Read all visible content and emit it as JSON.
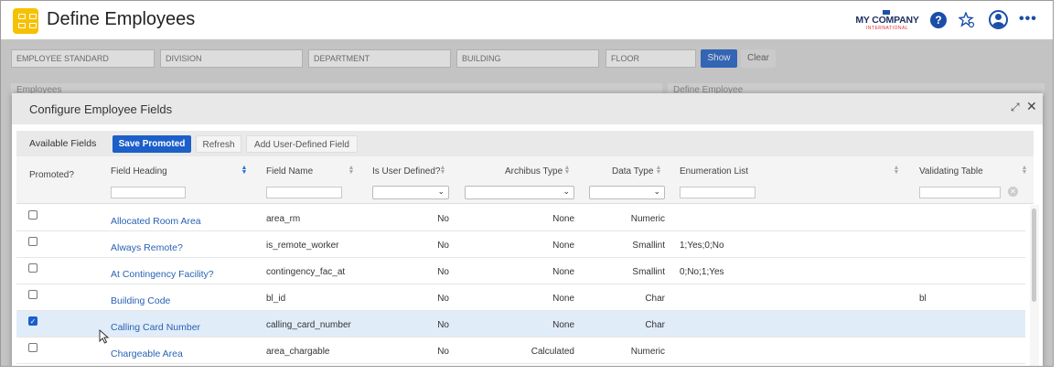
{
  "app": {
    "title": "Define Employees",
    "logo_name": "MY COMPANY",
    "logo_sub": "INTERNATIONAL",
    "help_label": "?",
    "more_label": "•••"
  },
  "filters": {
    "employee_standard": "EMPLOYEE STANDARD",
    "division": "DIVISION",
    "department": "DEPARTMENT",
    "building": "BUILDING",
    "floor": "FLOOR",
    "show_label": "Show",
    "clear_label": "Clear"
  },
  "background_panels": {
    "left_tabs": "Employees",
    "right_title": "Define Employee"
  },
  "dialog": {
    "title": "Configure Employee Fields",
    "toolbar": {
      "available_label": "Available Fields",
      "save_label": "Save Promoted",
      "refresh_label": "Refresh",
      "add_label": "Add User-Defined Field"
    },
    "columns": {
      "promoted": "Promoted?",
      "heading": "Field Heading",
      "name": "Field Name",
      "user_defined": "Is User Defined?",
      "archibus_type": "Archibus Type",
      "data_type": "Data Type",
      "enum_list": "Enumeration List",
      "validating_table": "Validating Table"
    },
    "rows": [
      {
        "promoted": false,
        "heading": "Allocated Room Area",
        "name": "area_rm",
        "user_defined": "No",
        "archibus_type": "None",
        "data_type": "Numeric",
        "enum_list": "",
        "validating_table": ""
      },
      {
        "promoted": false,
        "heading": "Always Remote?",
        "name": "is_remote_worker",
        "user_defined": "No",
        "archibus_type": "None",
        "data_type": "Smallint",
        "enum_list": "1;Yes;0;No",
        "validating_table": ""
      },
      {
        "promoted": false,
        "heading": "At Contingency Facility?",
        "name": "contingency_fac_at",
        "user_defined": "No",
        "archibus_type": "None",
        "data_type": "Smallint",
        "enum_list": "0;No;1;Yes",
        "validating_table": ""
      },
      {
        "promoted": false,
        "heading": "Building Code",
        "name": "bl_id",
        "user_defined": "No",
        "archibus_type": "None",
        "data_type": "Char",
        "enum_list": "",
        "validating_table": "bl"
      },
      {
        "promoted": true,
        "heading": "Calling Card Number",
        "name": "calling_card_number",
        "user_defined": "No",
        "archibus_type": "None",
        "data_type": "Char",
        "enum_list": "",
        "validating_table": ""
      },
      {
        "promoted": false,
        "heading": "Chargeable Area",
        "name": "area_chargable",
        "user_defined": "No",
        "archibus_type": "Calculated",
        "data_type": "Numeric",
        "enum_list": "",
        "validating_table": ""
      }
    ]
  },
  "icons": {
    "app": "grid-icon",
    "help": "help-icon",
    "favorites": "star-settings-icon",
    "user": "user-avatar-icon",
    "more": "more-icon",
    "expand": "expand-icon",
    "close": "close-icon"
  },
  "colors": {
    "accent": "#1c5fc9",
    "app_icon": "#f6c100",
    "link": "#2962b4",
    "selected_row": "#e1ecf9"
  }
}
